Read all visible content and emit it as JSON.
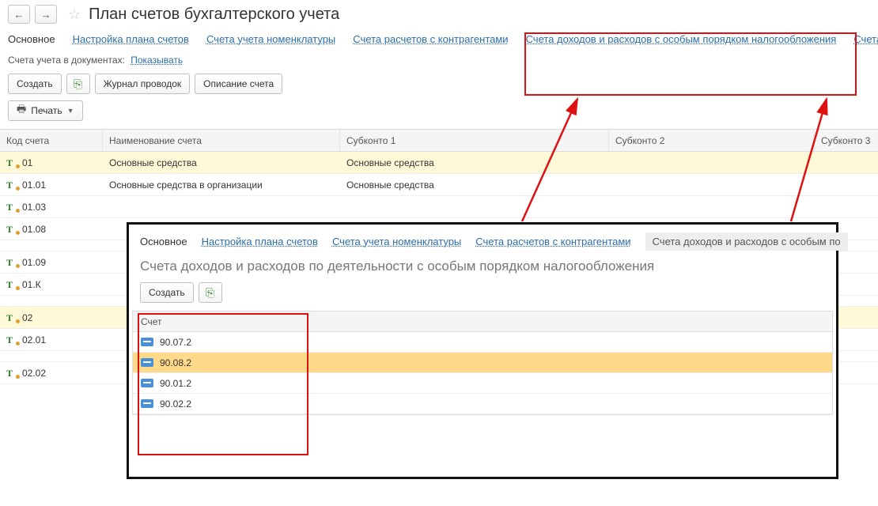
{
  "header": {
    "title": "План счетов бухгалтерского учета"
  },
  "tabs": {
    "main": "Основное",
    "t1": "Настройка плана счетов",
    "t2": "Счета учета номенклатуры",
    "t3": "Счета расчетов с контрагентами",
    "t4": "Счета доходов и расходов с особым порядком налогообложения",
    "t5": "Счета"
  },
  "filter": {
    "label": "Счета учета в документах:",
    "value": "Показывать"
  },
  "toolbar": {
    "create": "Создать",
    "journal": "Журнал проводок",
    "desc": "Описание счета",
    "print": "Печать"
  },
  "columns": {
    "code": "Код счета",
    "name": "Наименование счета",
    "sk1": "Субконто 1",
    "sk2": "Субконто 2",
    "sk3": "Субконто 3"
  },
  "rows": [
    {
      "code": "01",
      "name": "Основные средства",
      "sk1": "Основные средства",
      "sel": true
    },
    {
      "code": "01.01",
      "name": "Основные средства в организации",
      "sk1": "Основные средства"
    },
    {
      "code": "01.03",
      "name": "",
      "sk1": ""
    },
    {
      "code": "01.08",
      "name": "",
      "sk1": ""
    },
    {
      "code": "01.09",
      "name": "",
      "sk1": ""
    },
    {
      "code": "01.К",
      "name": "",
      "sk1": ""
    },
    {
      "code": "02",
      "name": "",
      "sk1": "",
      "sel": true
    },
    {
      "code": "02.01",
      "name": "",
      "sk1": ""
    },
    {
      "code": "02.02",
      "name": "",
      "sk1": ""
    }
  ],
  "popup": {
    "tabs": {
      "main": "Основное",
      "t1": "Настройка плана счетов",
      "t2": "Счета учета номенклатуры",
      "t3": "Счета расчетов с контрагентами",
      "t4": "Счета доходов и расходов с особым по"
    },
    "title": "Счета доходов и расходов по деятельности с особым порядком налогообложения",
    "toolbar": {
      "create": "Создать"
    },
    "column": "Счет",
    "rows": [
      {
        "code": "90.07.2"
      },
      {
        "code": "90.08.2",
        "sel": true
      },
      {
        "code": "90.01.2"
      },
      {
        "code": "90.02.2"
      }
    ]
  }
}
